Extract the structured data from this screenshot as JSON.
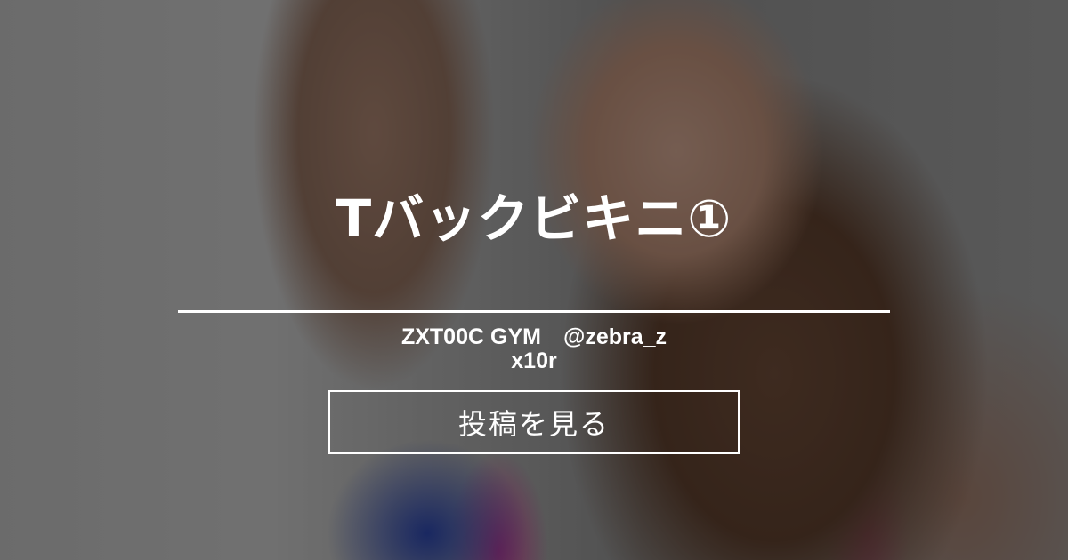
{
  "post": {
    "title": "Tバックビキニ①",
    "author": "ZXT00C GYM　@zebra_zx10r",
    "view_button_label": "投稿を見る"
  },
  "colors": {
    "overlay": "rgba(0,0,0,0.42)",
    "text": "#ffffff",
    "swimsuit_blue": "#2c45a8",
    "swimsuit_pink": "#c23890"
  }
}
